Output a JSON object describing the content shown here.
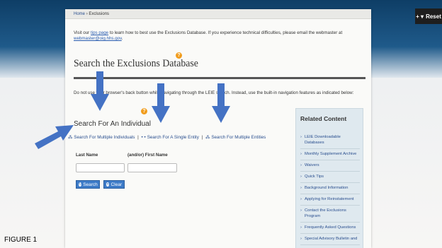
{
  "toolbar": {
    "reset_label": "Reset"
  },
  "breadcrumb": {
    "home": "Home",
    "sep": "›",
    "current": "Exclusions"
  },
  "notice": {
    "pre": "Visit our ",
    "link": "tips page",
    "mid": " to learn how to best use the Exclusions Database. If you experience technical difficulties, please email the webmaster at ",
    "email": "webmaster@oig.hhs.gov",
    "post": "."
  },
  "page_title": "Search the Exclusions Database",
  "warning": "Do not use your browser's back button while navigating through the LEIE search. Instead, use the built-in navigation features as indicated below:",
  "section_title": "Search For An Individual",
  "links": {
    "multiple_individuals": "Search For Multiple Individuals",
    "single_entity": "Search For A Single Entity",
    "multiple_entities": "Search For Multiple Entities",
    "separator": "|"
  },
  "form": {
    "last_name_label": "Last Name",
    "first_name_label": "(and/or) First Name",
    "last_name_value": "",
    "first_name_value": "",
    "search_label": "Search",
    "clear_label": "Clear"
  },
  "related": {
    "title": "Related Content",
    "items": [
      "LEIE Downloadable Databases",
      "Monthly Supplement Archive",
      "Waivers",
      "Quick Tips",
      "Background Information",
      "Applying for Reinstatement",
      "Contact the Exclusions Program",
      "Frequently Asked Questions",
      "Special Advisory Bulletin and"
    ]
  },
  "figure_label": "FIGURE 1",
  "colors": {
    "arrow": "#4472c4",
    "link": "#2a4f8f",
    "button": "#3d7bc8",
    "help_icon": "#f19d1e",
    "related_bg": "#dfe9ef"
  },
  "icons": {
    "reset": "plus-chevron-icon",
    "help": "help-bubble-icon",
    "search": "refresh-search-icon",
    "clear": "clear-icon",
    "link": "people-icon"
  }
}
